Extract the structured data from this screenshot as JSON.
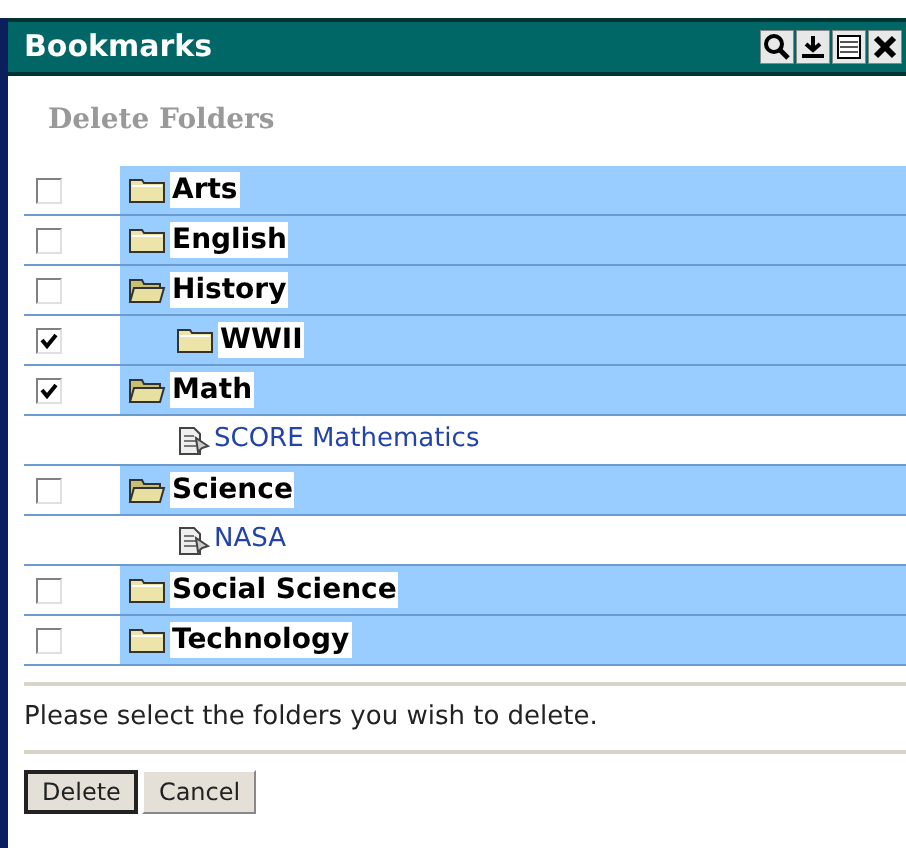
{
  "window": {
    "title": "Bookmarks"
  },
  "heading": "Delete Folders",
  "tree": [
    {
      "kind": "folder",
      "label": "Arts",
      "checked": false,
      "expanded": false
    },
    {
      "kind": "folder",
      "label": "English",
      "checked": false,
      "expanded": false
    },
    {
      "kind": "folder",
      "label": "History",
      "checked": false,
      "expanded": true,
      "children": [
        {
          "kind": "folder",
          "label": "WWII",
          "checked": true,
          "expanded": false
        }
      ]
    },
    {
      "kind": "folder",
      "label": "Math",
      "checked": true,
      "expanded": true,
      "children": [
        {
          "kind": "link",
          "label": "SCORE Mathematics"
        }
      ]
    },
    {
      "kind": "folder",
      "label": "Science",
      "checked": false,
      "expanded": true,
      "children": [
        {
          "kind": "link",
          "label": "NASA"
        }
      ]
    },
    {
      "kind": "folder",
      "label": "Social Science",
      "checked": false,
      "expanded": false
    },
    {
      "kind": "folder",
      "label": "Technology",
      "checked": false,
      "expanded": false
    }
  ],
  "message": "Please select the folders you wish to delete.",
  "buttons": [
    {
      "label": "Delete",
      "default": true
    },
    {
      "label": "Cancel",
      "default": false
    }
  ]
}
